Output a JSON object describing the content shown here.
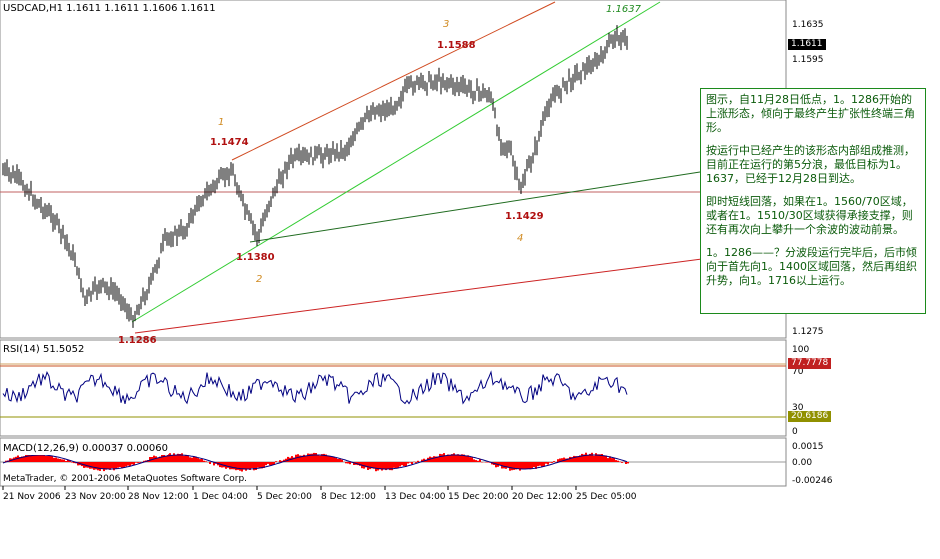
{
  "chart_header": {
    "symbol_text": "USDCAD,H1  1.1611  1.1611  1.1606  1.1611"
  },
  "price_axis": {
    "ticks": [
      "1.1635",
      "1.1595",
      "1.1275"
    ],
    "current_price": "1.1611"
  },
  "price_labels": {
    "p1588": "1.1588",
    "p1637": "1.1637",
    "p1474": "1.1474",
    "p1429": "1.1429",
    "p1380": "1.1380",
    "p1286": "1.1286"
  },
  "wave_labels": {
    "w1": "1",
    "w2": "2",
    "w3": "3",
    "w4": "4"
  },
  "rsi": {
    "title": "RSI(14) 51.5052",
    "ticks": [
      "100",
      "70",
      "30",
      "0"
    ],
    "upper_level": "77.7778",
    "lower_level": "20.6186"
  },
  "macd": {
    "title": "MACD(12,26,9) 0.00037 0.00060",
    "ticks": [
      "0.0015",
      "0.00",
      "-0.00246"
    ]
  },
  "footer": {
    "copyright": "MetaTrader, © 2001-2006 MetaQuotes Software Corp."
  },
  "time_axis": {
    "labels": [
      "21 Nov 2006",
      "23 Nov 20:00",
      "28 Nov 12:00",
      "1 Dec 04:00",
      "5 Dec 20:00",
      "8 Dec 12:00",
      "13 Dec 04:00",
      "15 Dec 20:00",
      "20 Dec 12:00",
      "25 Dec 05:00"
    ]
  },
  "annotation": {
    "para1": "图示，自11月28日低点，1。1286开始的上涨形态，倾向于最终产生扩张性终端三角形。",
    "para2": "按运行中已经产生的该形态内部组成推测，目前正在运行的第5分浪，最低目标为1。1637，已经于12月28日到达。",
    "para3": "即时短线回落，如果在1。1560/70区域，或者在1。1510/30区域获得承接支撑，则还有再次向上攀升一个余波的波动前景。",
    "para4": "1。1286——？分波段运行完毕后，后市倾向于首先向1。1400区域回落，然后再组织升势，向1。1716以上运行。"
  },
  "colors": {
    "bg": "#ffffff",
    "candle": "#000000",
    "green_line": "#33cc33",
    "dark_green": "#1f6b1f",
    "red_line": "#cc2222",
    "rsi_line": "#000080",
    "macd_hist": "#ff0000"
  }
}
